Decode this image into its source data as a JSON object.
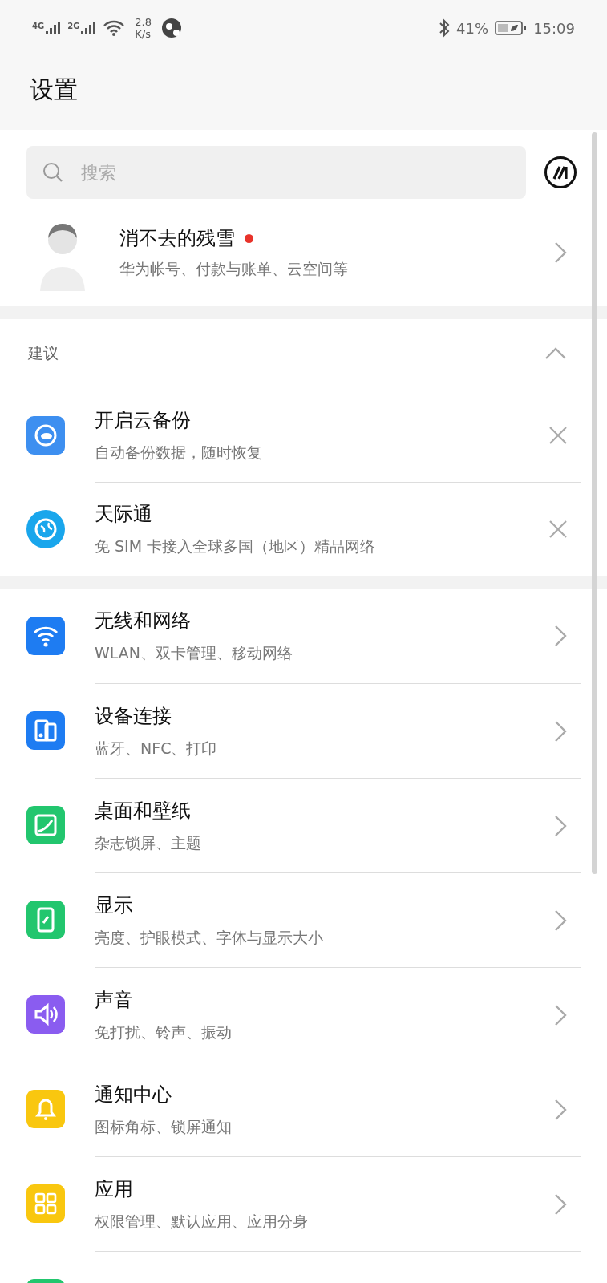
{
  "status_bar": {
    "network_1": "4G",
    "network_2": "2G",
    "speed_value": "2.8",
    "speed_unit": "K/s",
    "battery": "41%",
    "time": "15:09"
  },
  "title": "设置",
  "search": {
    "placeholder": "搜索"
  },
  "account": {
    "name": "消不去的残雪",
    "subtitle": "华为帐号、付款与账单、云空间等",
    "has_notification": true
  },
  "suggestions": {
    "header": "建议",
    "expanded": true,
    "items": [
      {
        "kind": "cloud",
        "color": "#3d8ff0",
        "title": "开启云备份",
        "subtitle": "自动备份数据，随时恢复"
      },
      {
        "kind": "globe",
        "color": "#19a6ec",
        "title": "天际通",
        "subtitle": "免 SIM 卡接入全球多国（地区）精品网络"
      }
    ]
  },
  "settings": [
    {
      "kind": "wifi",
      "color": "#1e7cf2",
      "title": "无线和网络",
      "subtitle": "WLAN、双卡管理、移动网络"
    },
    {
      "kind": "devices",
      "color": "#1e7cf2",
      "title": "设备连接",
      "subtitle": "蓝牙、NFC、打印"
    },
    {
      "kind": "wallpaper",
      "color": "#22c66e",
      "title": "桌面和壁纸",
      "subtitle": "杂志锁屏、主题"
    },
    {
      "kind": "display",
      "color": "#22c66e",
      "title": "显示",
      "subtitle": "亮度、护眼模式、字体与显示大小"
    },
    {
      "kind": "sound",
      "color": "#8a5cf0",
      "title": "声音",
      "subtitle": "免打扰、铃声、振动"
    },
    {
      "kind": "bell",
      "color": "#f9c70f",
      "title": "通知中心",
      "subtitle": "图标角标、锁屏通知"
    },
    {
      "kind": "apps",
      "color": "#f9c70f",
      "title": "应用",
      "subtitle": "权限管理、默认应用、应用分身"
    },
    {
      "kind": "partial",
      "color": "#22c66e"
    }
  ]
}
